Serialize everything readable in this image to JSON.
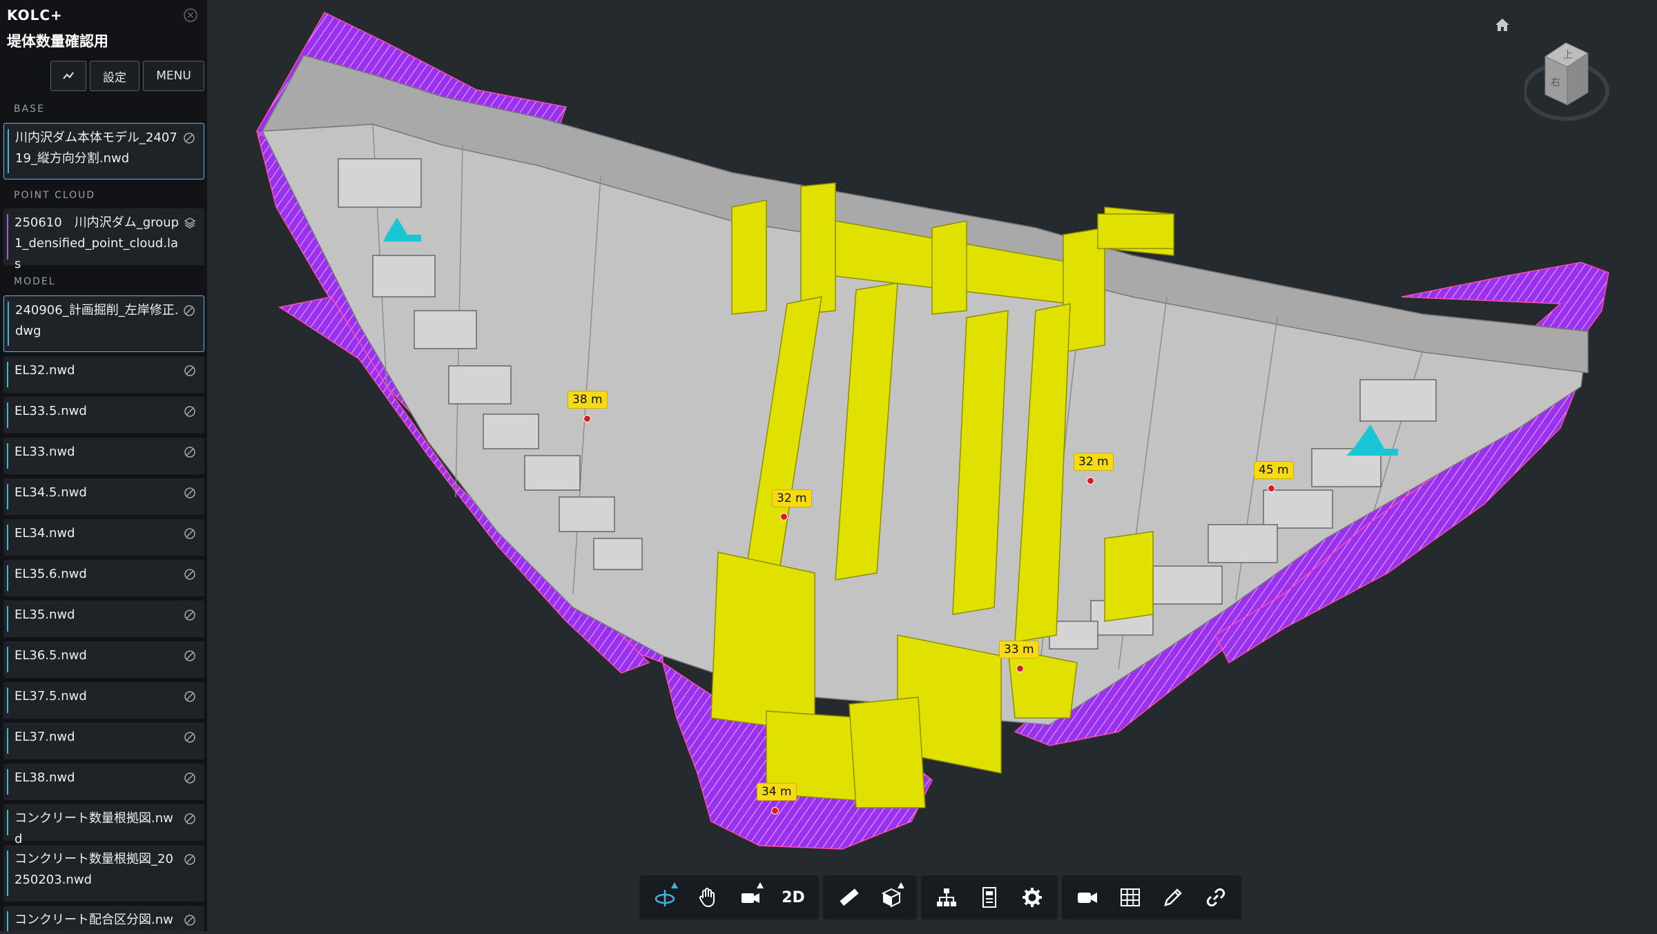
{
  "sidebar": {
    "app_name": "KOLC+",
    "project_name": "堤体数量確認用",
    "buttons": {
      "chart_icon": "chart-line-icon",
      "settings": "設定",
      "menu": "MENU"
    },
    "sections": {
      "base": "BASE",
      "point_cloud": "POINT CLOUD",
      "model": "MODEL"
    },
    "base_items": [
      {
        "label": "川内沢ダム本体モデル_240719_縦方向分割.nwd"
      }
    ],
    "point_cloud_items": [
      {
        "label": "250610　川内沢ダム_group1_densified_point_cloud.las"
      }
    ],
    "model_items": [
      {
        "label": "240906_計画掘削_左岸修正.dwg"
      },
      {
        "label": "EL32.nwd"
      },
      {
        "label": "EL33.5.nwd"
      },
      {
        "label": "EL33.nwd"
      },
      {
        "label": "EL34.5.nwd"
      },
      {
        "label": "EL34.nwd"
      },
      {
        "label": "EL35.6.nwd"
      },
      {
        "label": "EL35.nwd"
      },
      {
        "label": "EL36.5.nwd"
      },
      {
        "label": "EL37.5.nwd"
      },
      {
        "label": "EL37.nwd"
      },
      {
        "label": "EL38.nwd"
      },
      {
        "label": "コンクリート数量根拠図.nwd"
      },
      {
        "label": "コンクリート数量根拠図_20250203.nwd"
      },
      {
        "label": "コンクリート配合区分図.nwd"
      }
    ]
  },
  "viewport": {
    "view_cube": {
      "top_face": "上",
      "front_face": "右"
    },
    "measurements": [
      "38 m",
      "32 m",
      "32 m",
      "45 m",
      "33 m",
      "34 m"
    ],
    "colors": {
      "terrain": "#9b30f0",
      "concrete": "#c8c8c8",
      "gallery": "#e1e100",
      "accent": "#19c6d6"
    }
  },
  "toolbar": {
    "two_d_label": "2D"
  }
}
